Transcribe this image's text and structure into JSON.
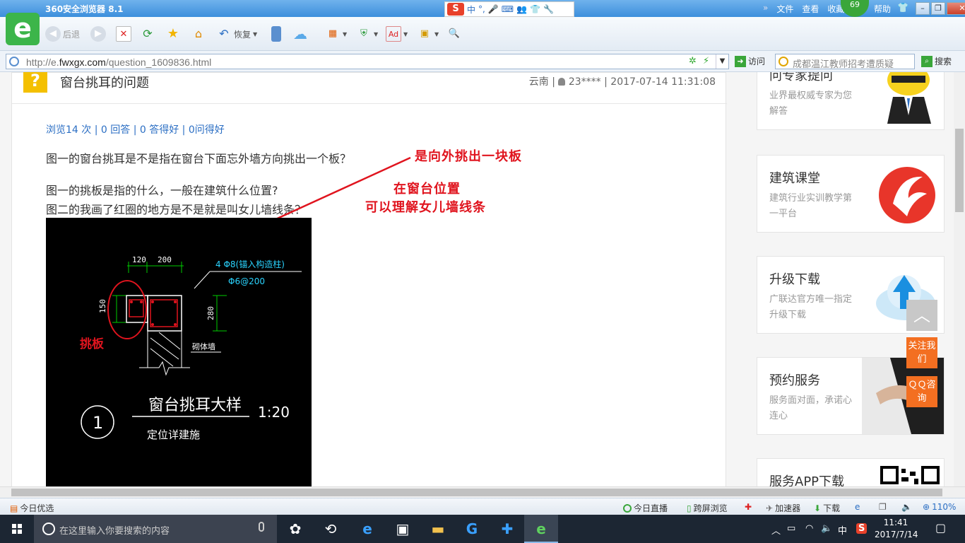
{
  "browser": {
    "title": "360安全浏览器 8.1",
    "menu": [
      "文件",
      "查看",
      "收藏",
      "帮助"
    ],
    "fold": "»",
    "badge": "69",
    "toolbar": {
      "back": "后退",
      "restore": "恢复"
    },
    "address": {
      "prefix": "http://e.",
      "domain": "fwxgx.com",
      "path": "/question_1609836.html"
    },
    "visit_label": "访问",
    "search_text": "成都温江教师招考遭质疑",
    "search_label": "搜索"
  },
  "ime": {
    "logo": "S",
    "mode": "中",
    "punct": "°,"
  },
  "question": {
    "title": "窗台挑耳的问题",
    "region": "云南",
    "user": "23****",
    "datetime": "2017-07-14 11:31:08",
    "stats": "浏览14 次 | 0 回答 | 0 答得好 | 0问得好",
    "line1": "图一的窗台挑耳是不是指在窗台下面忘外墙方向挑出一个板？",
    "line2": "图一的挑板是指的什么，一般在建筑什么位置?",
    "line3": "图二的我画了红圈的地方是不是就是叫女儿墙线条？"
  },
  "annotations": {
    "a1": "是向外挑出一块板",
    "a2": "在窗台位置",
    "a3": "可以理解女儿墙线条"
  },
  "drawing": {
    "dim_a": "120",
    "dim_b": "200",
    "rebar": "4 Φ8(锚入构造柱)",
    "stirrup": "Φ6@200",
    "height_left": "150",
    "height_right": "280",
    "wall_label": "砌体墙",
    "red_label": "挑板",
    "detail_no": "1",
    "detail_title": "窗台挑耳大样",
    "scale": "1:20",
    "detail_sub": "定位详建施"
  },
  "sidebar": [
    {
      "title": "问专家提问",
      "desc": "业界最权威专家为您解答"
    },
    {
      "title": "建筑课堂",
      "desc": "建筑行业实训教学第一平台"
    },
    {
      "title": "升级下载",
      "desc": "广联达官方唯一指定升级下载"
    },
    {
      "title": "预约服务",
      "desc": "服务面对面，承诺心连心"
    },
    {
      "title": "服务APP下载",
      "desc": ""
    }
  ],
  "floats": {
    "follow": "关注我们",
    "qq": "ＱＱ咨询"
  },
  "statusbar": {
    "left": "今日优选",
    "live": "今日直播",
    "cross": "跨屏浏览",
    "accel": "加速器",
    "download": "下载",
    "zoom": "110%"
  },
  "taskbar": {
    "search_placeholder": "在这里输入你要搜索的内容",
    "ime": "中",
    "time": "11:41",
    "date": "2017/7/14"
  }
}
